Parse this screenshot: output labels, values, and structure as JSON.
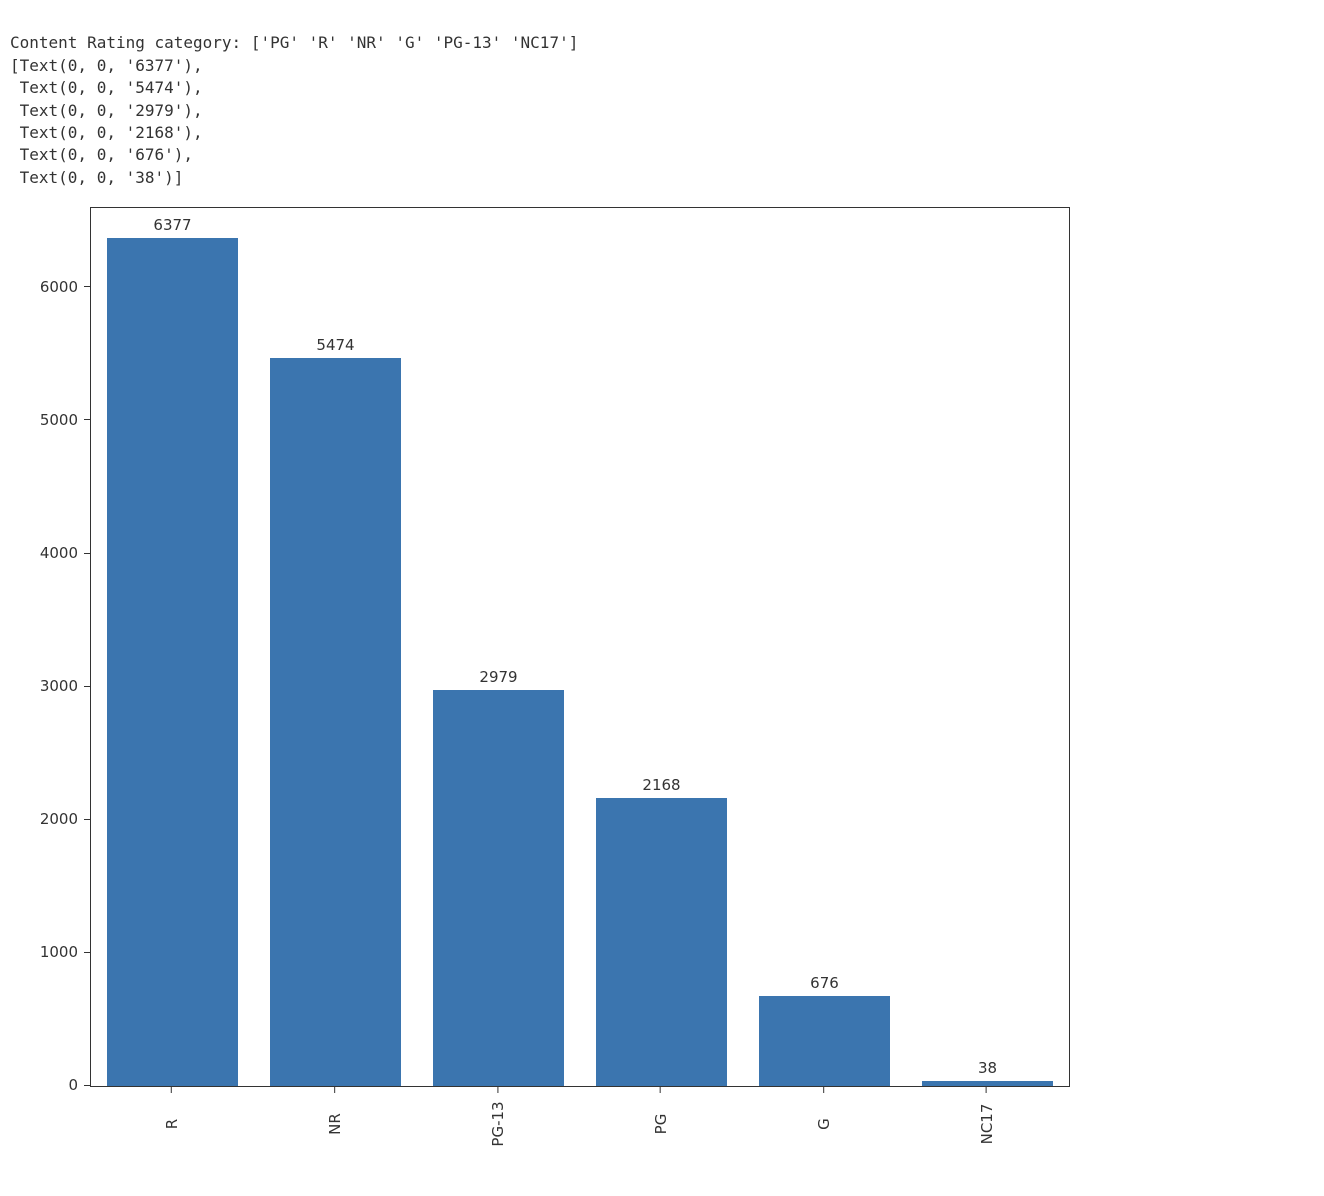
{
  "code_output": {
    "line1": "Content Rating category: ['PG' 'R' 'NR' 'G' 'PG-13' 'NC17']",
    "line2": "[Text(0, 0, '6377'),",
    "line3": " Text(0, 0, '5474'),",
    "line4": " Text(0, 0, '2979'),",
    "line5": " Text(0, 0, '2168'),",
    "line6": " Text(0, 0, '676'),",
    "line7": " Text(0, 0, '38')]"
  },
  "chart_data": {
    "type": "bar",
    "categories": [
      "R",
      "NR",
      "PG-13",
      "PG",
      "G",
      "NC17"
    ],
    "values": [
      6377,
      5474,
      2979,
      2168,
      676,
      38
    ],
    "title": "",
    "xlabel": "",
    "ylabel": "",
    "ylim": [
      0,
      6600
    ],
    "y_ticks": [
      0,
      1000,
      2000,
      3000,
      4000,
      5000,
      6000
    ],
    "bar_color": "#3b75af"
  }
}
